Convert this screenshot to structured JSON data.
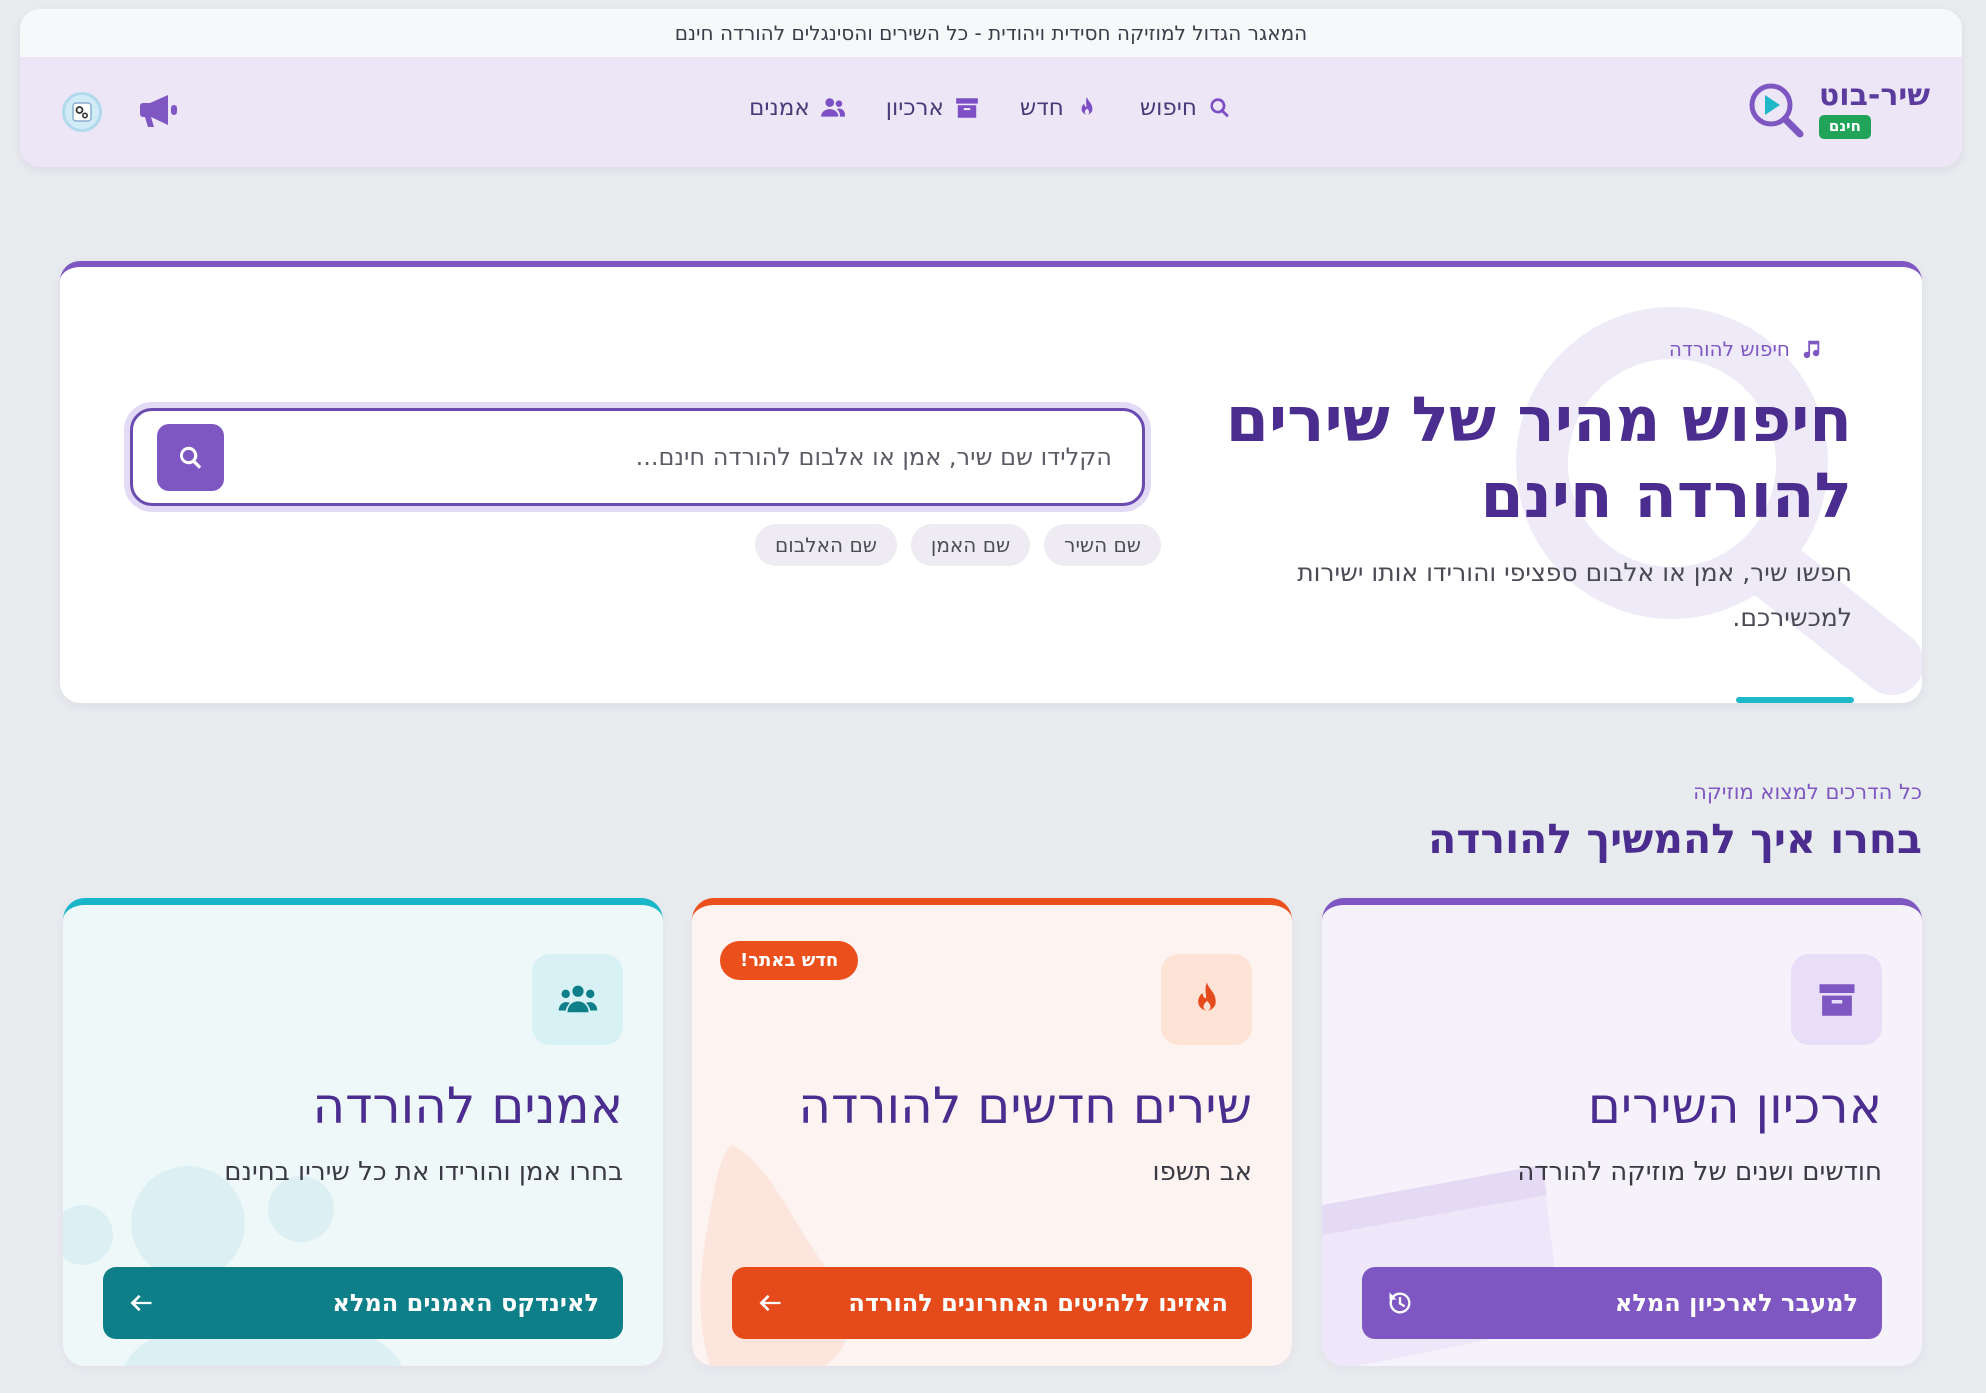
{
  "top_strip": "המאגר הגדול למוזיקה חסידית ויהודית - כל השירים והסינגלים להורדה חינם",
  "logo": {
    "name": "שיר-בוט",
    "badge": "חינם"
  },
  "nav": [
    {
      "label": "חיפוש",
      "icon": "search-icon"
    },
    {
      "label": "חדש",
      "icon": "fire-icon"
    },
    {
      "label": "ארכיון",
      "icon": "archive-icon"
    },
    {
      "label": "אמנים",
      "icon": "users-icon"
    }
  ],
  "hero": {
    "tag": "חיפוש להורדה",
    "title": "חיפוש מהיר של שירים להורדה חינם",
    "description": "חפשו שיר, אמן או אלבום ספציפי והורידו אותו ישירות למכשירכם.",
    "search_placeholder": "הקלידו שם שיר, אמן או אלבום להורדה חינם...",
    "chips": [
      "שם השיר",
      "שם האמן",
      "שם האלבום"
    ]
  },
  "section": {
    "subtitle": "כל הדרכים למצוא מוזיקה",
    "title": "בחרו איך להמשיך להורדה"
  },
  "cards": [
    {
      "title": "ארכיון השירים",
      "description": "חודשים ושנים של מוזיקה להורדה",
      "button": "למעבר לארכיון המלא",
      "icon": "archive-icon",
      "button_icon": "history-icon"
    },
    {
      "title": "שירים חדשים להורדה",
      "description": "אב תשפו",
      "button": "האזינו ללהיטים האחרונים להורדה",
      "badge": "חדש באתר!",
      "icon": "fire-icon",
      "button_icon": "arrow-left-icon"
    },
    {
      "title": "אמנים להורדה",
      "description": "בחרו אמן והורידו את כל שיריו בחינם",
      "button": "לאינדקס האמנים המלא",
      "icon": "users-icon",
      "button_icon": "arrow-left-icon"
    }
  ],
  "colors": {
    "primary": "#7e57c2",
    "title": "#4b2c8f",
    "accent_orange": "#e54b1a",
    "accent_teal": "#0e7f89",
    "badge_green": "#22a35a"
  }
}
